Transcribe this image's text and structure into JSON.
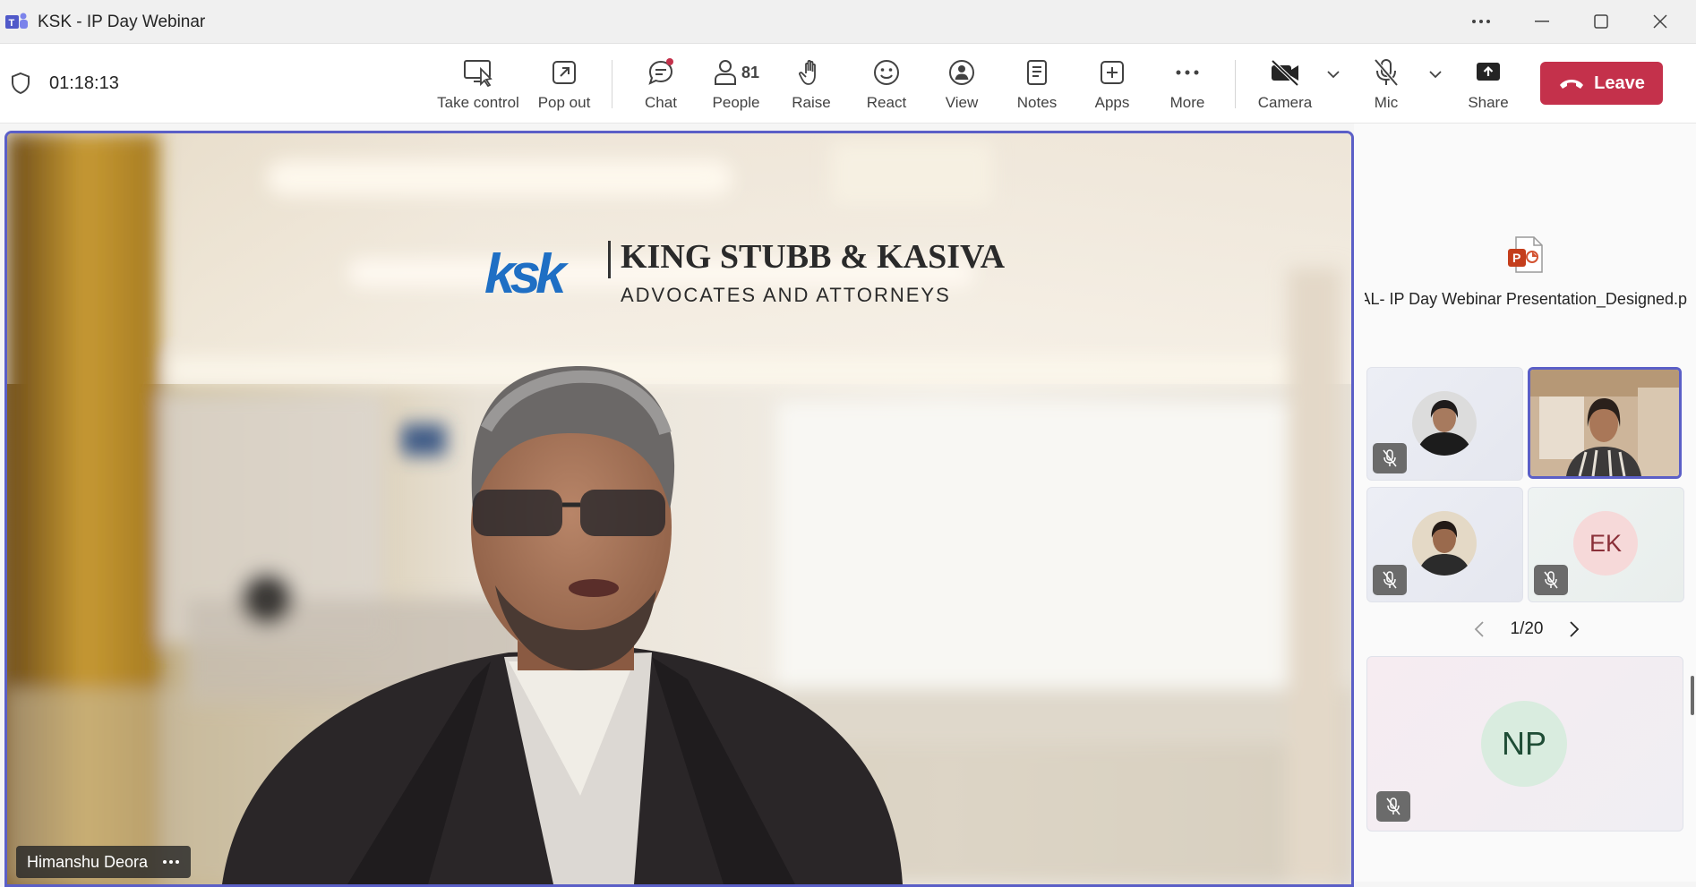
{
  "window": {
    "title": "KSK - IP Day Webinar"
  },
  "meeting": {
    "elapsed": "01:18:13"
  },
  "toolbar": {
    "take_control": "Take control",
    "pop_out": "Pop out",
    "chat": "Chat",
    "people": "People",
    "people_count": "81",
    "raise": "Raise",
    "react": "React",
    "view": "View",
    "notes": "Notes",
    "apps": "Apps",
    "more": "More",
    "camera": "Camera",
    "mic": "Mic",
    "share": "Share",
    "leave": "Leave"
  },
  "stage": {
    "speaker_name": "Himanshu Deora",
    "banner_logo": "ksk",
    "banner_title": "KING STUBB & KASIVA",
    "banner_subtitle": "ADVOCATES AND ATTORNEYS"
  },
  "side_panel": {
    "shared_file": "NAL- IP Day Webinar Presentation_Designed.p",
    "file_icon": "powerpoint-icon",
    "participants": [
      {
        "initials": "",
        "muted": true
      },
      {
        "initials": "",
        "muted": false
      },
      {
        "initials": "",
        "muted": true
      },
      {
        "initials": "EK",
        "muted": true
      },
      {
        "initials": "NP",
        "muted": true
      }
    ],
    "pager": "1/20"
  },
  "colors": {
    "accent": "#5b5fc7",
    "leave": "#c4314b",
    "chat_badge": "#c4314b"
  }
}
